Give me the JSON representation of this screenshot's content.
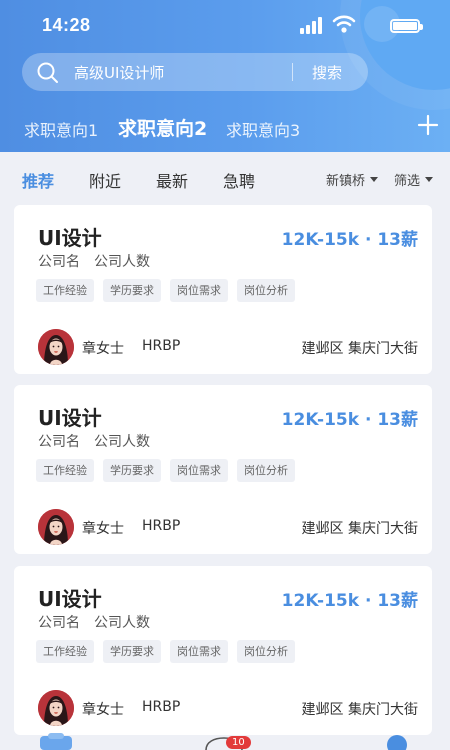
{
  "status_bar": {
    "time": "14:28"
  },
  "search": {
    "query": "高级UI设计师",
    "button_label": "搜索"
  },
  "intent_tabs": [
    {
      "label": "求职意向1",
      "active": false
    },
    {
      "label": "求职意向2",
      "active": true
    },
    {
      "label": "求职意向3",
      "active": false
    }
  ],
  "filter": {
    "tabs": [
      {
        "label": "推荐",
        "active": true
      },
      {
        "label": "附近",
        "active": false
      },
      {
        "label": "最新",
        "active": false
      },
      {
        "label": "急聘",
        "active": false
      }
    ],
    "location_select": "新镇桥",
    "filter_select": "筛选"
  },
  "jobs": [
    {
      "title": "UI设计",
      "salary": "12K-15k · 13薪",
      "company": "公司名",
      "size": "公司人数",
      "tags": [
        "工作经验",
        "学历要求",
        "岗位需求",
        "岗位分析"
      ],
      "recruiter_name": "章女士",
      "recruiter_role": "HRBP",
      "location": "建邺区 集庆门大街"
    },
    {
      "title": "UI设计",
      "salary": "12K-15k · 13薪",
      "company": "公司名",
      "size": "公司人数",
      "tags": [
        "工作经验",
        "学历要求",
        "岗位需求",
        "岗位分析"
      ],
      "recruiter_name": "章女士",
      "recruiter_role": "HRBP",
      "location": "建邺区 集庆门大街"
    },
    {
      "title": "UI设计",
      "salary": "12K-15k · 13薪",
      "company": "公司名",
      "size": "公司人数",
      "tags": [
        "工作经验",
        "学历要求",
        "岗位需求",
        "岗位分析"
      ],
      "recruiter_name": "章女士",
      "recruiter_role": "HRBP",
      "location": "建邺区 集庆门大街"
    }
  ],
  "bottom_nav": {
    "message_badge": "10"
  },
  "colors": {
    "accent": "#4a8ee0",
    "header_start": "#4f8ee2",
    "header_end": "#6cb0f4",
    "page_bg": "#eef0f6",
    "badge": "#e23a3a"
  },
  "icons": [
    "search-icon",
    "signal-icon",
    "wifi-icon",
    "battery-icon",
    "add-icon",
    "caret-down-icon",
    "avatar"
  ]
}
